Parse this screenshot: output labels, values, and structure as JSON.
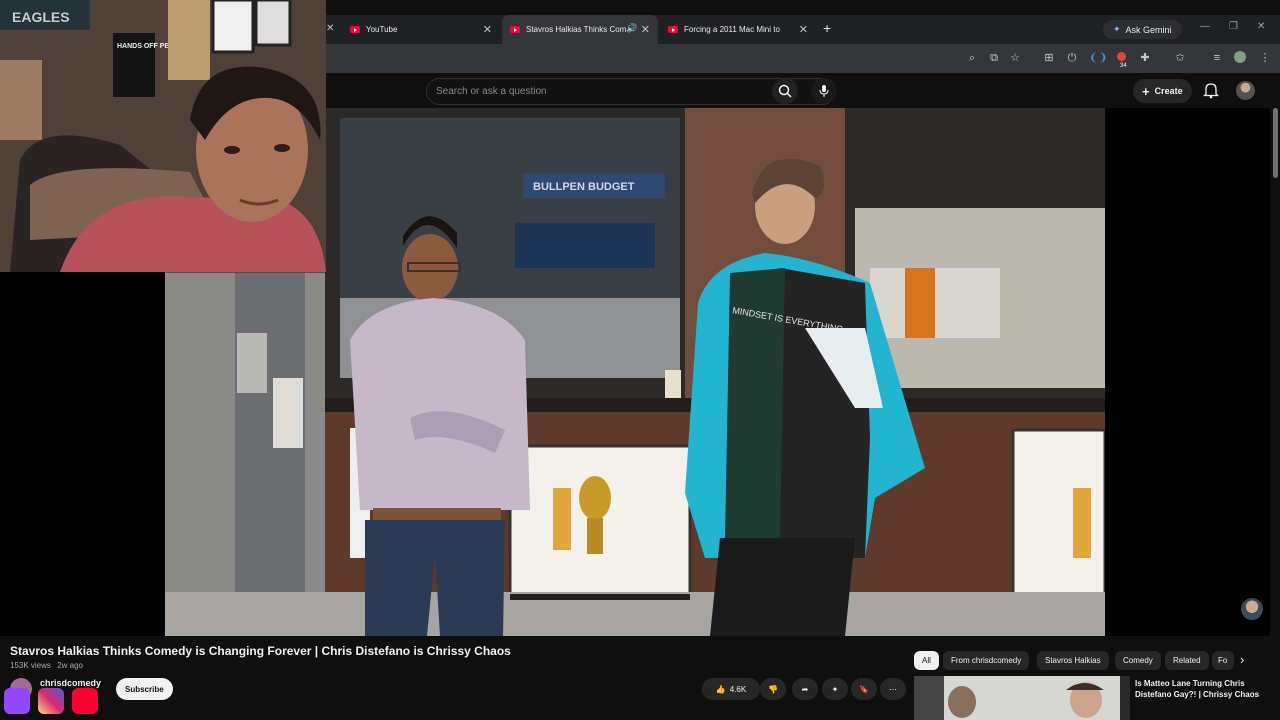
{
  "browser": {
    "tabs": [
      {
        "title": "YouTube"
      },
      {
        "title": "Stavros Halkias Thinks Comedy",
        "active": true
      },
      {
        "title": "Forcing a 2011 Mac Mini to"
      }
    ],
    "new_tab": "+",
    "gemini_label": "Ask Gemini",
    "extension_badge": "34"
  },
  "youtube": {
    "search_placeholder": "Search or ask a question",
    "create_label": "Create"
  },
  "video": {
    "title": "Stavros Halkias Thinks Comedy is Changing Forever | Chris Distefano is Chrissy Chaos",
    "views": "153K views",
    "age": "2w ago",
    "channel": "chrisdcomedy",
    "subscribe_label": "Subscribe",
    "likes": "4.6K",
    "scene_sign": "BULLPEN BUDGET",
    "shirt_text": "MINDSET IS EVERYTHING"
  },
  "chips": [
    "All",
    "From chrisdcomedy",
    "Stavros Halkias",
    "Comedy",
    "Related",
    "Fo"
  ],
  "recommendation": {
    "title": "Is Matteo Lane Turning Chris Distefano Gay?! | Chrissy Chaos"
  },
  "webcam_poster": "HANDS OFF PBS & NPR",
  "webcam_sign": "EAGLES",
  "colors": {
    "youtube_red": "#ff0033",
    "chrome_dark": "#202124",
    "jacket_teal": "#23b4d0",
    "twitch_purple": "#9146ff"
  }
}
